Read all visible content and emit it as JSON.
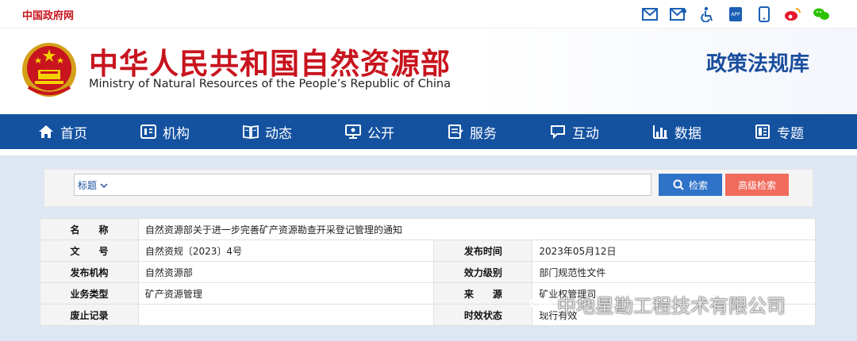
{
  "topbar": {
    "gov_link": "中国政府网"
  },
  "header": {
    "ministry_cn": "中华人民共和国自然资源部",
    "ministry_en": "Ministry of Natural Resources of the People’s Republic of China",
    "section_title": "政策法规库"
  },
  "nav": {
    "items": [
      {
        "label": "首页",
        "icon": "home-icon"
      },
      {
        "label": "机构",
        "icon": "org-icon"
      },
      {
        "label": "动态",
        "icon": "news-icon"
      },
      {
        "label": "公开",
        "icon": "disclosure-icon"
      },
      {
        "label": "服务",
        "icon": "service-icon"
      },
      {
        "label": "互动",
        "icon": "interaction-icon"
      },
      {
        "label": "数据",
        "icon": "chart-icon"
      },
      {
        "label": "专题",
        "icon": "topic-icon"
      }
    ]
  },
  "search": {
    "field_select": "标题",
    "search_button": "检索",
    "advanced_button": "高级检索"
  },
  "info": {
    "name_label": "名　　称",
    "name_value": "自然资源部关于进一步完善矿产资源勘查开采登记管理的通知",
    "doc_no_label": "文　　号",
    "doc_no_value": "自然资规〔2023〕4号",
    "publish_date_label": "发布时间",
    "publish_date_value": "2023年05月12日",
    "issuer_label": "发布机构",
    "issuer_value": "自然资源部",
    "level_label": "效力级别",
    "level_value": "部门规范性文件",
    "category_label": "业务类型",
    "category_value": "矿产资源管理",
    "source_label": "来　　源",
    "source_value": "矿业权管理司",
    "repeal_label": "废止记录",
    "repeal_value": "",
    "status_label": "时效状态",
    "status_value": "现行有效"
  },
  "watermark": {
    "text": "中地星勘工程技术有限公司"
  },
  "colors": {
    "brand_red": "#c8141e",
    "nav_blue": "#1452a0",
    "search_blue": "#2f73c9",
    "adv_red": "#f06b5c"
  }
}
